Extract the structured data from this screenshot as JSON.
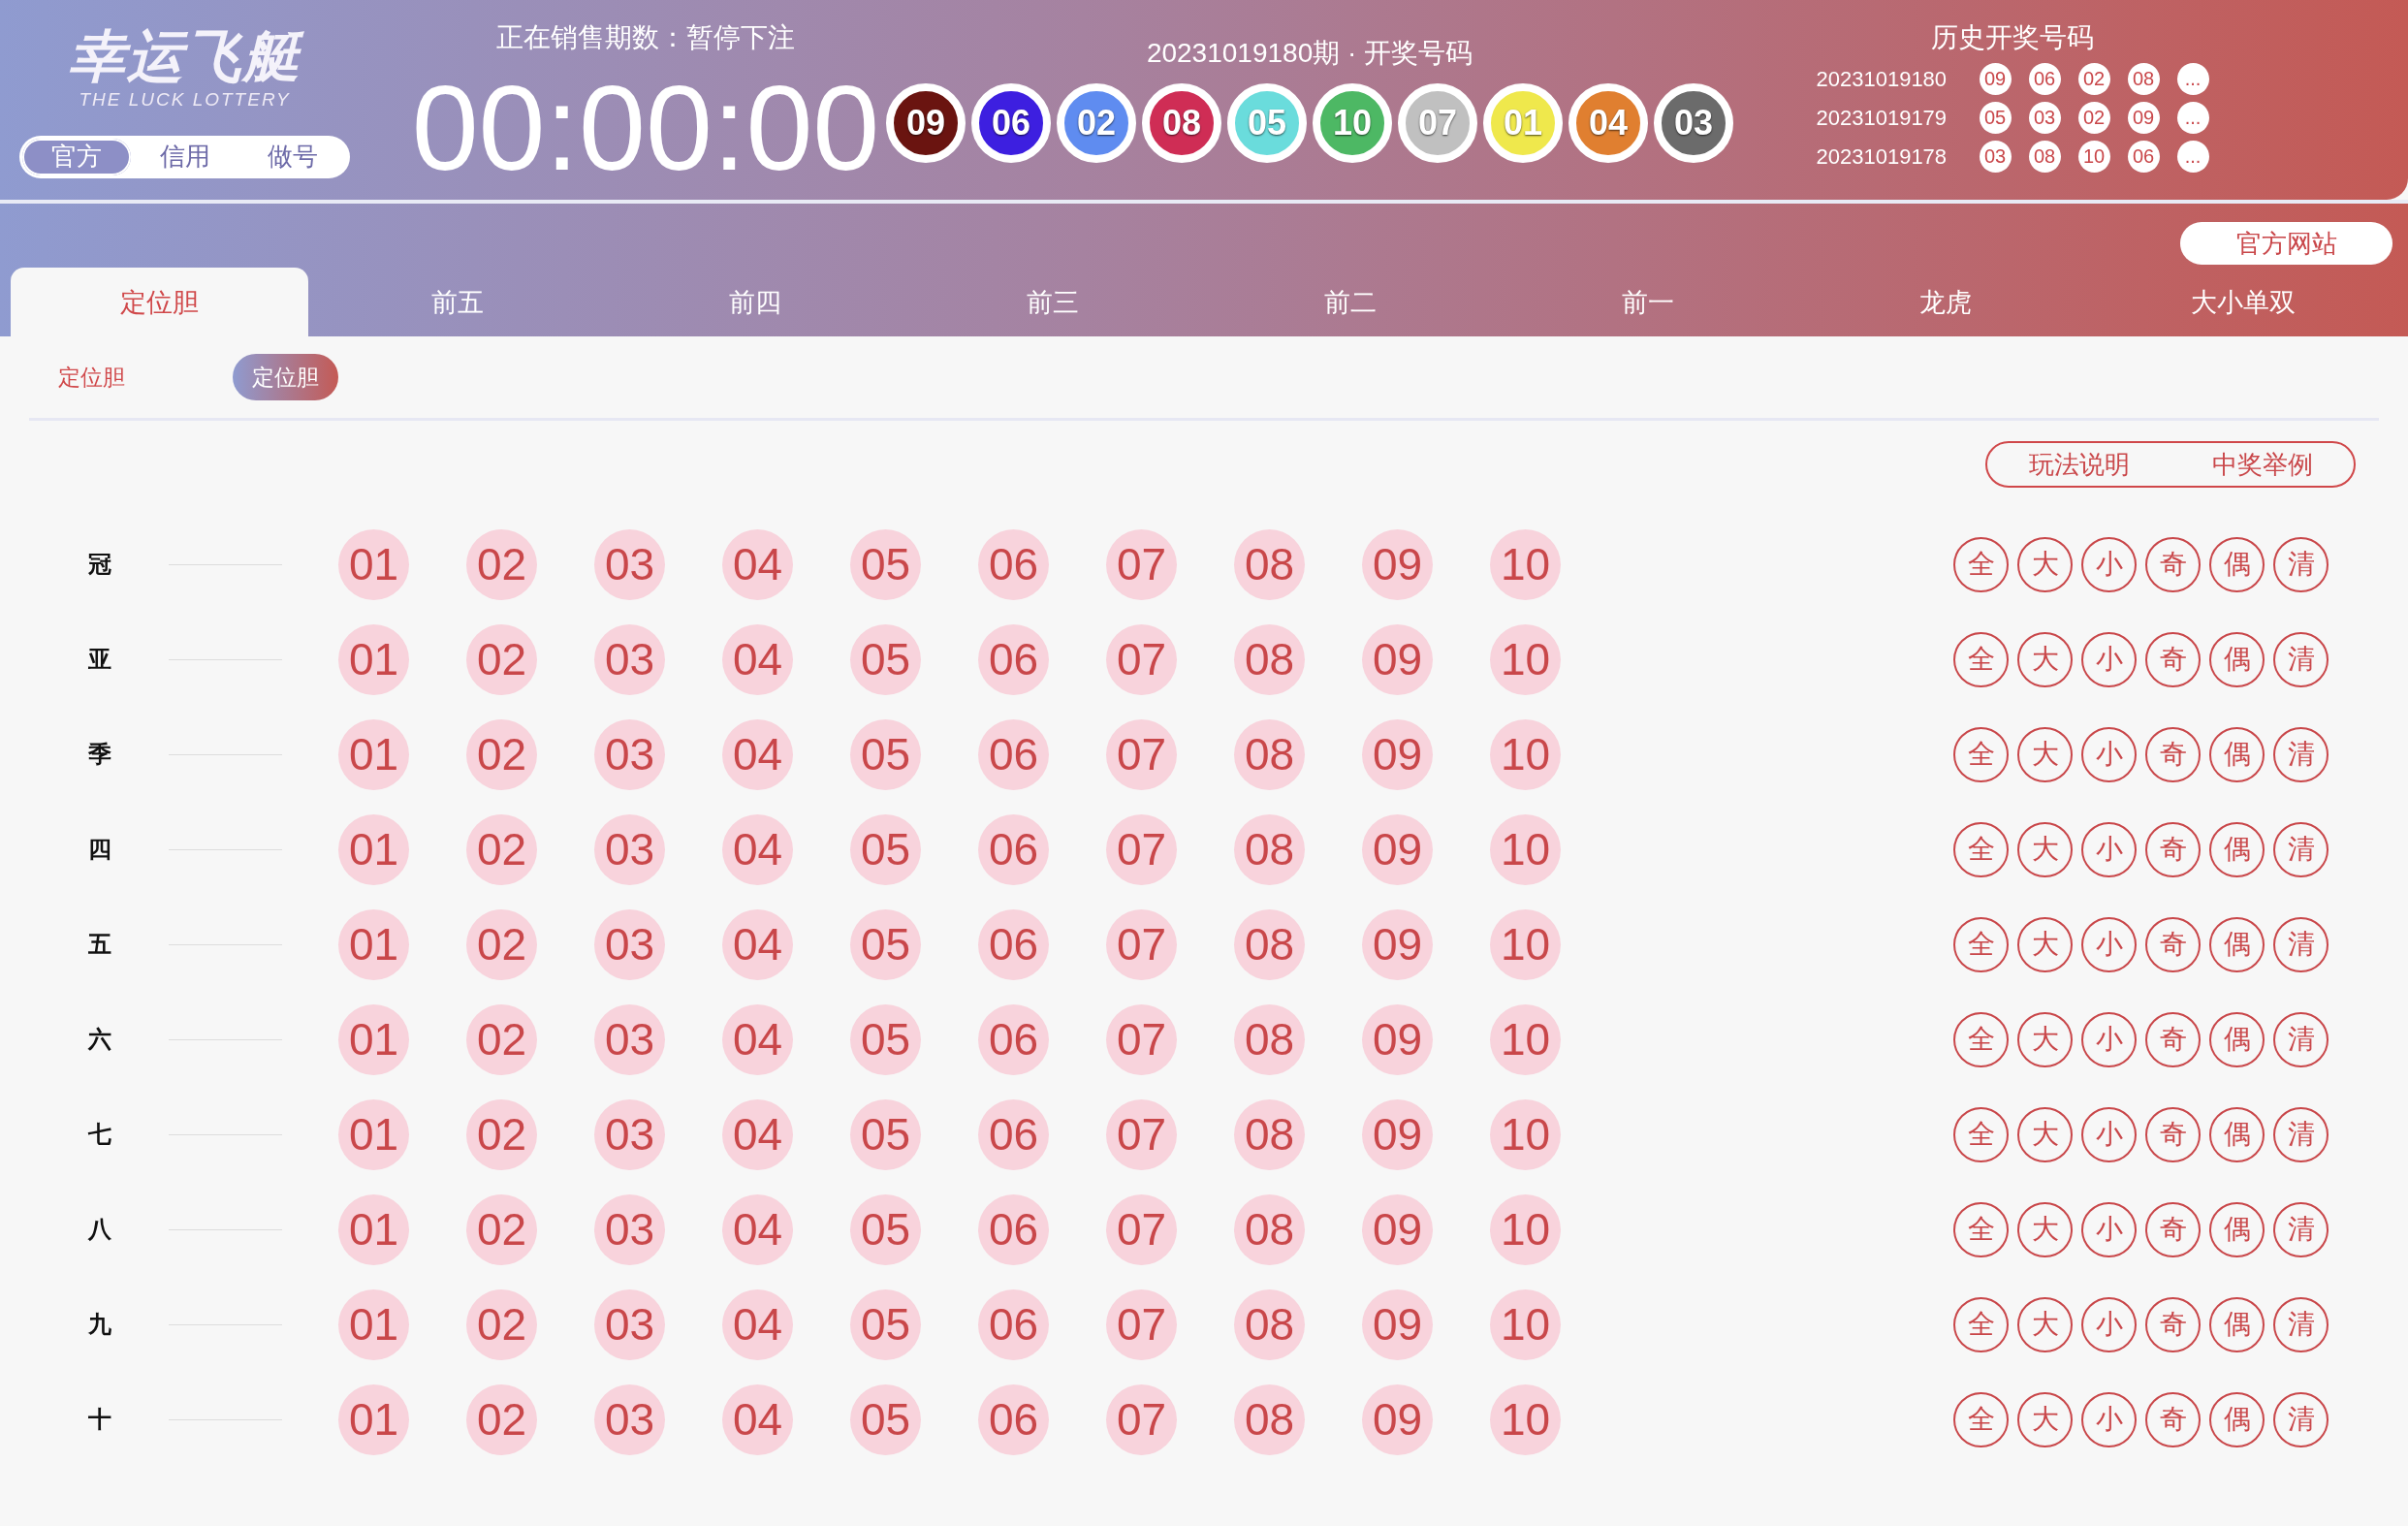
{
  "logo": {
    "title": "幸运飞艇",
    "subtitle": "THE LUCK LOTTERY"
  },
  "modes": [
    {
      "label": "官方",
      "selected": true
    },
    {
      "label": "信用",
      "selected": false
    },
    {
      "label": "做号",
      "selected": false
    }
  ],
  "countdown": {
    "label": "正在销售期数：暂停下注",
    "time": "00:00:00"
  },
  "current_draw": {
    "label": "20231019180期 · 开奖号码",
    "balls": [
      {
        "number": "09",
        "color": "#6a1410"
      },
      {
        "number": "06",
        "color": "#3d1fe0"
      },
      {
        "number": "02",
        "color": "#5f8cf0"
      },
      {
        "number": "08",
        "color": "#cf2d55"
      },
      {
        "number": "05",
        "color": "#6adcdc"
      },
      {
        "number": "10",
        "color": "#4db864"
      },
      {
        "number": "07",
        "color": "#c0c0c0"
      },
      {
        "number": "01",
        "color": "#efe84c"
      },
      {
        "number": "04",
        "color": "#e07f30"
      },
      {
        "number": "03",
        "color": "#6b6b6b"
      }
    ]
  },
  "history": {
    "title": "历史开奖号码",
    "rows": [
      {
        "issue": "20231019180",
        "numbers": [
          "09",
          "06",
          "02",
          "08",
          "..."
        ]
      },
      {
        "issue": "20231019179",
        "numbers": [
          "05",
          "03",
          "02",
          "09",
          "..."
        ]
      },
      {
        "issue": "20231019178",
        "numbers": [
          "03",
          "08",
          "10",
          "06",
          "..."
        ]
      }
    ]
  },
  "official_site_button": "官方网站",
  "tabs": [
    {
      "label": "定位胆",
      "selected": true
    },
    {
      "label": "前五",
      "selected": false
    },
    {
      "label": "前四",
      "selected": false
    },
    {
      "label": "前三",
      "selected": false
    },
    {
      "label": "前二",
      "selected": false
    },
    {
      "label": "前一",
      "selected": false
    },
    {
      "label": "龙虎",
      "selected": false
    },
    {
      "label": "大小单双",
      "selected": false
    }
  ],
  "sub_tabs": {
    "group_label": "定位胆",
    "options": [
      {
        "label": "定位胆",
        "selected": true
      }
    ]
  },
  "help_buttons": [
    "玩法说明",
    "中奖举例"
  ],
  "rows": [
    {
      "label": "冠",
      "numbers": [
        "01",
        "02",
        "03",
        "04",
        "05",
        "06",
        "07",
        "08",
        "09",
        "10"
      ],
      "quick": [
        "全",
        "大",
        "小",
        "奇",
        "偶",
        "清"
      ]
    },
    {
      "label": "亚",
      "numbers": [
        "01",
        "02",
        "03",
        "04",
        "05",
        "06",
        "07",
        "08",
        "09",
        "10"
      ],
      "quick": [
        "全",
        "大",
        "小",
        "奇",
        "偶",
        "清"
      ]
    },
    {
      "label": "季",
      "numbers": [
        "01",
        "02",
        "03",
        "04",
        "05",
        "06",
        "07",
        "08",
        "09",
        "10"
      ],
      "quick": [
        "全",
        "大",
        "小",
        "奇",
        "偶",
        "清"
      ]
    },
    {
      "label": "四",
      "numbers": [
        "01",
        "02",
        "03",
        "04",
        "05",
        "06",
        "07",
        "08",
        "09",
        "10"
      ],
      "quick": [
        "全",
        "大",
        "小",
        "奇",
        "偶",
        "清"
      ]
    },
    {
      "label": "五",
      "numbers": [
        "01",
        "02",
        "03",
        "04",
        "05",
        "06",
        "07",
        "08",
        "09",
        "10"
      ],
      "quick": [
        "全",
        "大",
        "小",
        "奇",
        "偶",
        "清"
      ]
    },
    {
      "label": "六",
      "numbers": [
        "01",
        "02",
        "03",
        "04",
        "05",
        "06",
        "07",
        "08",
        "09",
        "10"
      ],
      "quick": [
        "全",
        "大",
        "小",
        "奇",
        "偶",
        "清"
      ]
    },
    {
      "label": "七",
      "numbers": [
        "01",
        "02",
        "03",
        "04",
        "05",
        "06",
        "07",
        "08",
        "09",
        "10"
      ],
      "quick": [
        "全",
        "大",
        "小",
        "奇",
        "偶",
        "清"
      ]
    },
    {
      "label": "八",
      "numbers": [
        "01",
        "02",
        "03",
        "04",
        "05",
        "06",
        "07",
        "08",
        "09",
        "10"
      ],
      "quick": [
        "全",
        "大",
        "小",
        "奇",
        "偶",
        "清"
      ]
    },
    {
      "label": "九",
      "numbers": [
        "01",
        "02",
        "03",
        "04",
        "05",
        "06",
        "07",
        "08",
        "09",
        "10"
      ],
      "quick": [
        "全",
        "大",
        "小",
        "奇",
        "偶",
        "清"
      ]
    },
    {
      "label": "十",
      "numbers": [
        "01",
        "02",
        "03",
        "04",
        "05",
        "06",
        "07",
        "08",
        "09",
        "10"
      ],
      "quick": [
        "全",
        "大",
        "小",
        "奇",
        "偶",
        "清"
      ]
    }
  ]
}
